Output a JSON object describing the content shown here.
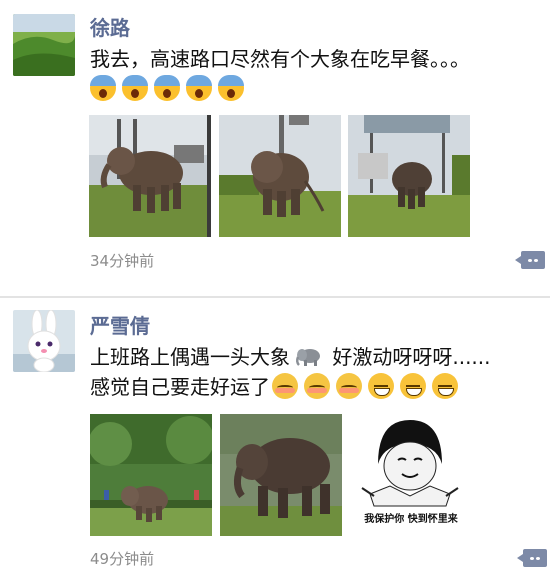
{
  "posts": [
    {
      "author": "徐路",
      "text_line1": "我去，高速路口尽然有个大象在吃早餐。。。",
      "emoji_icons": [
        "face-screaming-in-fear-icon",
        "face-screaming-in-fear-icon",
        "face-screaming-in-fear-icon",
        "face-screaming-in-fear-icon",
        "face-screaming-in-fear-icon"
      ],
      "time": "34分钟前"
    },
    {
      "author": "严雪倩",
      "text_line1_before": "上班路上偶遇一头大象",
      "text_line1_after": " 好激动呀呀呀......",
      "text_line2": "感觉自己要走好运了",
      "emoji_icons": [
        "elephant-icon",
        "flushed-face-icon",
        "grinning-face-icon"
      ],
      "meme_caption": "我保护你  快到怀里来",
      "time": "49分钟前"
    }
  ]
}
